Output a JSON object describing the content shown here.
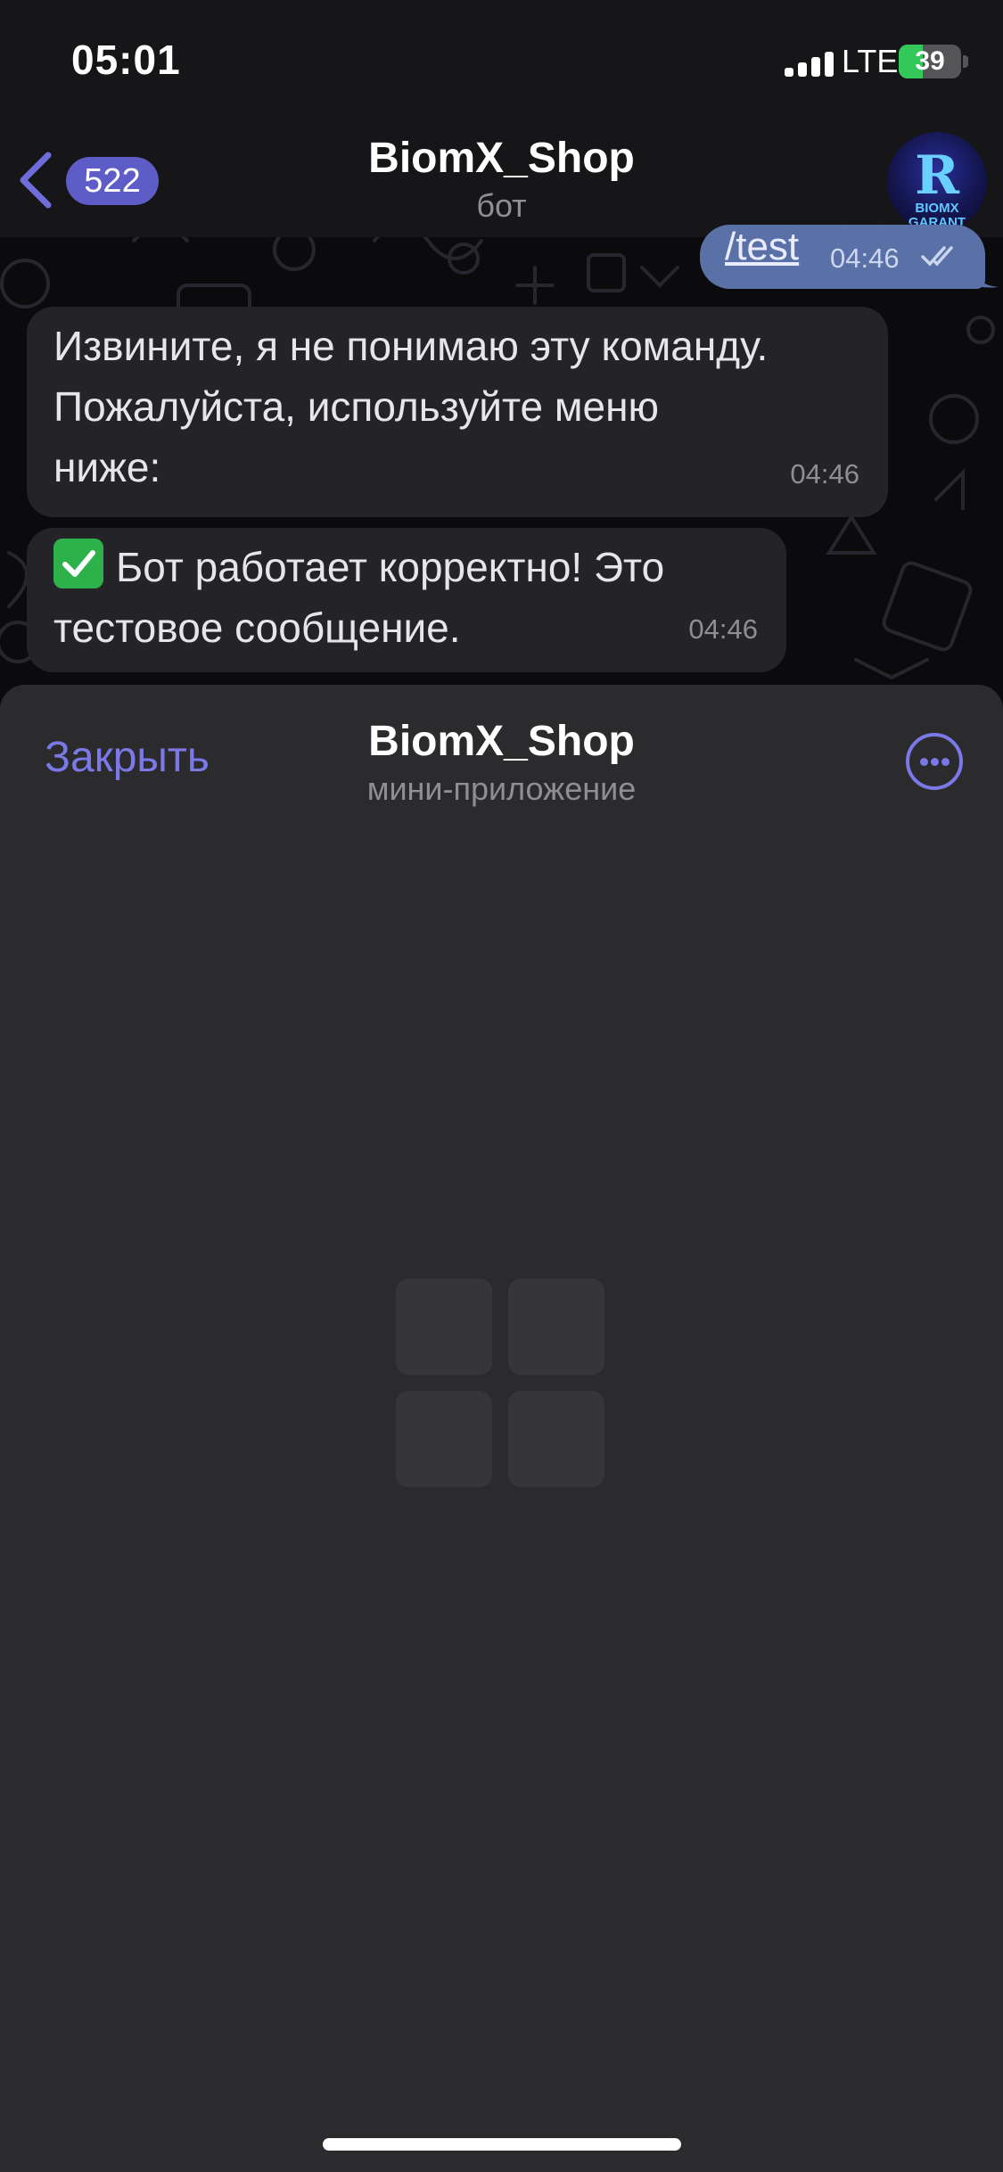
{
  "status_bar": {
    "time": "05:01",
    "network": "LTE",
    "battery_percent": 39,
    "battery_label": "39",
    "battery_color": "#34c759"
  },
  "chat_header": {
    "back_icon": "chevron-left-icon",
    "unread_count": "522",
    "title": "BiomX_Shop",
    "subtitle": "бот",
    "avatar": {
      "letter": "R",
      "text_line1": "BIOMX",
      "text_line2": "GARANT"
    }
  },
  "messages": [
    {
      "direction": "out",
      "text": "/test",
      "time": "04:46",
      "status_icon": "double-check-icon"
    },
    {
      "direction": "in",
      "lines": [
        "Извините, я не понимаю эту команду.",
        "Пожалуйста, используйте меню",
        "ниже:"
      ],
      "time": "04:46"
    },
    {
      "direction": "in",
      "emoji_icon": "check-mark-button-icon",
      "lines": [
        "Бот работает корректно! Это",
        "тестовое сообщение."
      ],
      "time": "04:46"
    }
  ],
  "mini_app": {
    "close_label": "Закрыть",
    "title": "BiomX_Shop",
    "subtitle": "мини-приложение",
    "more_icon": "more-dots-icon",
    "loading_icon": "grid-placeholder-icon"
  },
  "colors": {
    "accent": "#7b78e8",
    "badge": "#5e5cc6",
    "outgoing_bubble": "#5a71a8",
    "incoming_bubble": "#242428",
    "sheet_background": "#2b2b2d"
  }
}
